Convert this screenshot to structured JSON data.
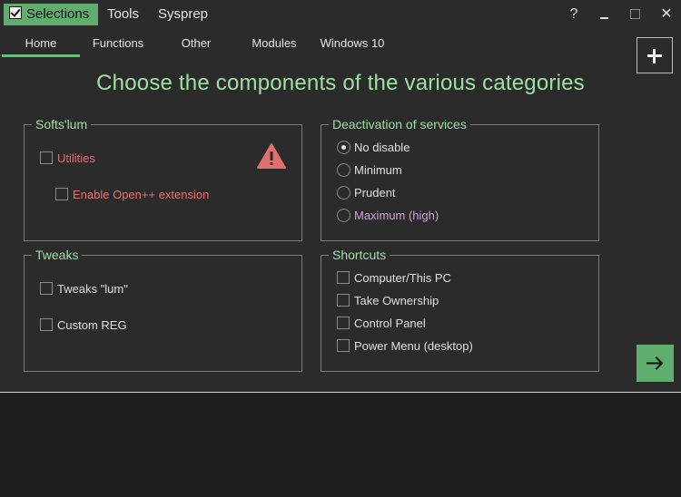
{
  "menubar": {
    "selections": "Selections",
    "tools": "Tools",
    "sysprep": "Sysprep",
    "help": "?",
    "close": "✕"
  },
  "tabs": [
    {
      "label": "Home",
      "active": true
    },
    {
      "label": "Functions"
    },
    {
      "label": "Other"
    },
    {
      "label": "Modules"
    },
    {
      "label": "Windows 10"
    }
  ],
  "heading": "Choose the components of the various categories",
  "softs": {
    "title": "Softs'lum",
    "utilities": "Utilities",
    "openpp": "Enable Open++ extension"
  },
  "deactivation": {
    "title": "Deactivation of services",
    "options": [
      "No disable",
      "Minimum",
      "Prudent",
      "Maximum (high)"
    ],
    "selected": "No disable"
  },
  "tweaks": {
    "title": "Tweaks",
    "items": [
      "Tweaks \"lum\"",
      "Custom REG"
    ]
  },
  "shortcuts": {
    "title": "Shortcuts",
    "items": [
      "Computer/This PC",
      "Take Ownership",
      "Control Panel",
      "Power Menu (desktop)"
    ]
  },
  "colors": {
    "accent": "#5fae6e",
    "heading": "#9ee0a2",
    "warning": "#e07070",
    "background": "#2b2b2b"
  }
}
